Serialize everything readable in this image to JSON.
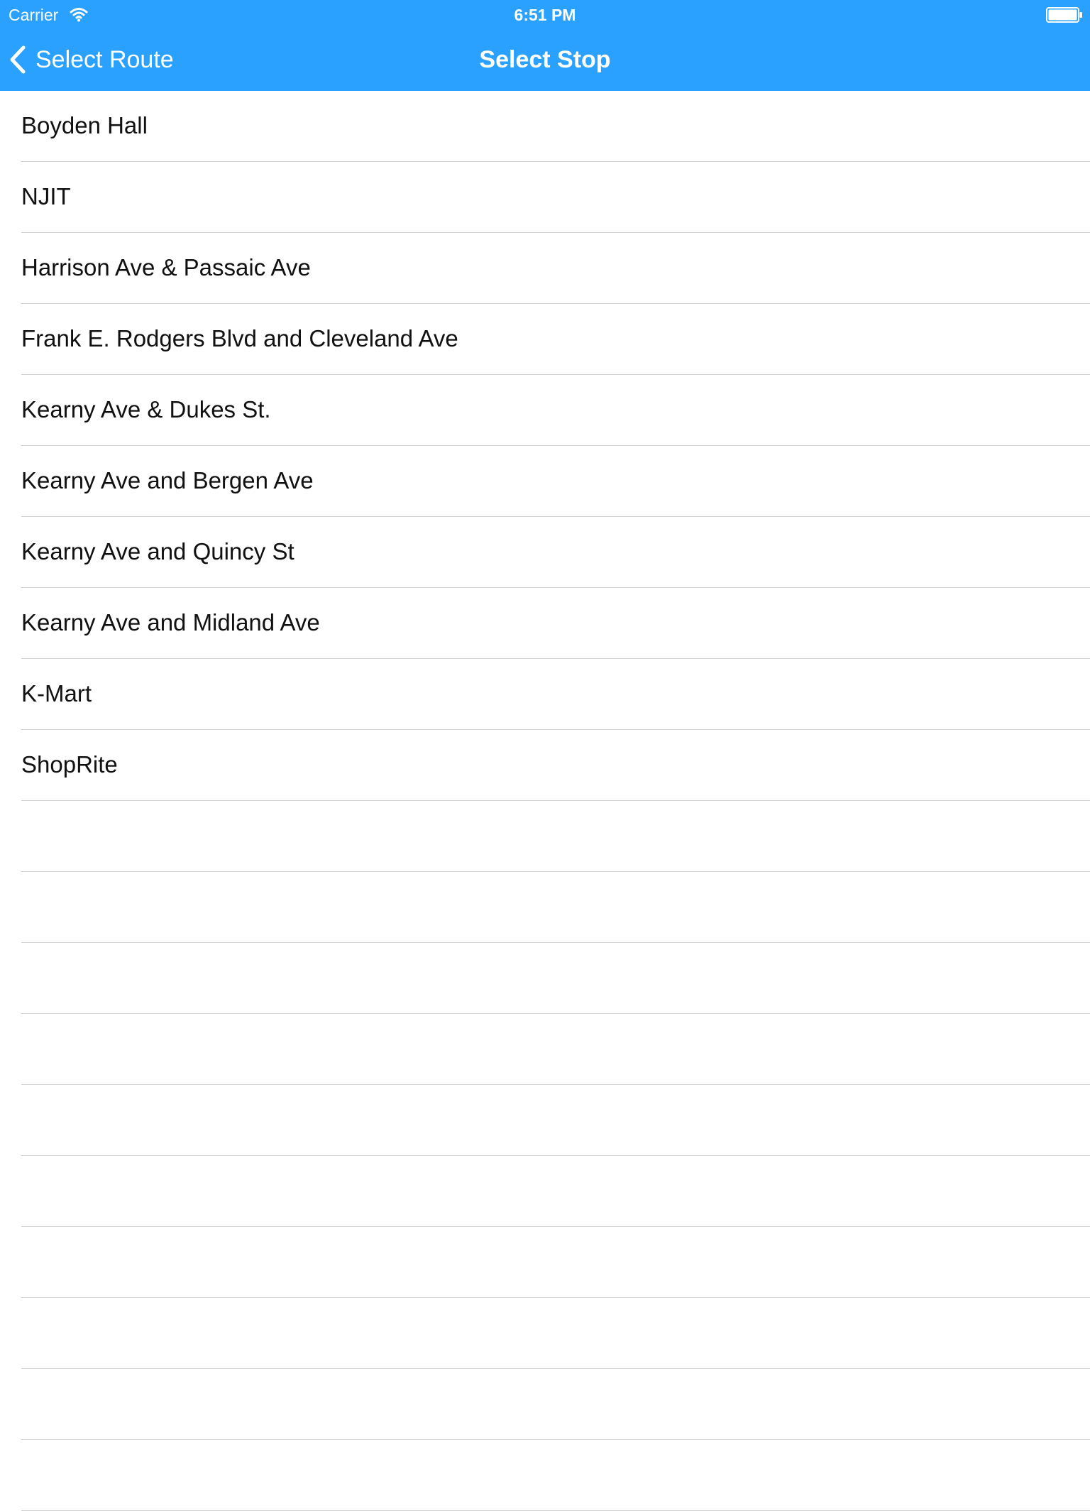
{
  "status_bar": {
    "carrier": "Carrier",
    "time": "6:51 PM"
  },
  "nav": {
    "back_label": "Select Route",
    "title": "Select Stop"
  },
  "stops": [
    "Boyden Hall",
    "NJIT",
    "Harrison Ave & Passaic Ave",
    "Frank E. Rodgers Blvd and Cleveland Ave",
    "Kearny Ave & Dukes St.",
    "Kearny Ave and Bergen Ave",
    "Kearny Ave and Quincy St",
    "Kearny Ave and Midland Ave",
    "K-Mart",
    "ShopRite"
  ],
  "colors": {
    "nav_background": "#2aa1fe",
    "nav_text": "#ffffff",
    "separator": "#d0d0d4"
  },
  "icons": {
    "wifi": "wifi-icon",
    "battery": "battery-icon",
    "back": "chevron-left-icon"
  }
}
